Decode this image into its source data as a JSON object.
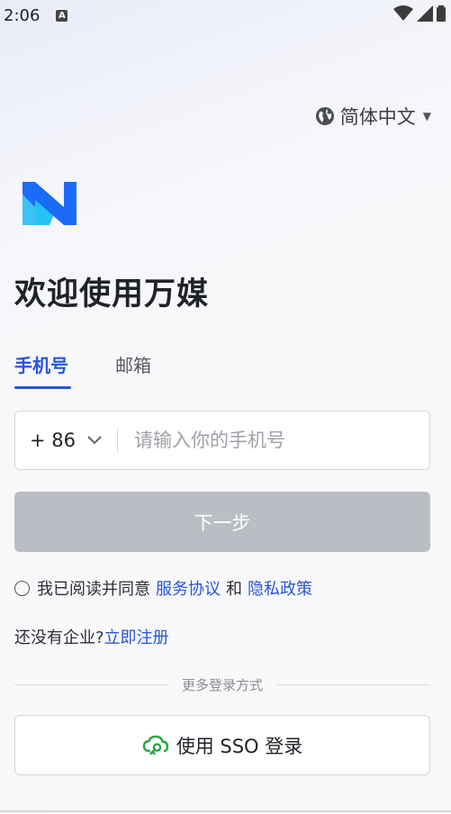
{
  "status_bar": {
    "time": "2:06",
    "notification_glyph": "A"
  },
  "language": {
    "label": "简体中文",
    "icon": "globe-icon"
  },
  "logo": {
    "colors": [
      "#1a6cf6",
      "#27c3f5"
    ]
  },
  "welcome": {
    "title": "欢迎使用万媒"
  },
  "tabs": [
    {
      "label": "手机号",
      "active": true
    },
    {
      "label": "邮箱",
      "active": false
    }
  ],
  "phone": {
    "country_code": "+ 86",
    "placeholder": "请输入你的手机号",
    "value": ""
  },
  "next_button": {
    "label": "下一步"
  },
  "agreement": {
    "prefix": "我已阅读并同意",
    "terms_link": "服务协议",
    "joiner": "和",
    "privacy_link": "隐私政策"
  },
  "register": {
    "prompt": "还没有企业?",
    "link": "立即注册"
  },
  "more_login": {
    "label": "更多登录方式"
  },
  "sso_button": {
    "label": "使用 SSO 登录",
    "icon": "cloud-key-icon"
  },
  "colors": {
    "accent": "#2655d8",
    "disabled_button": "#babdc4",
    "sso_icon": "#27a644"
  }
}
